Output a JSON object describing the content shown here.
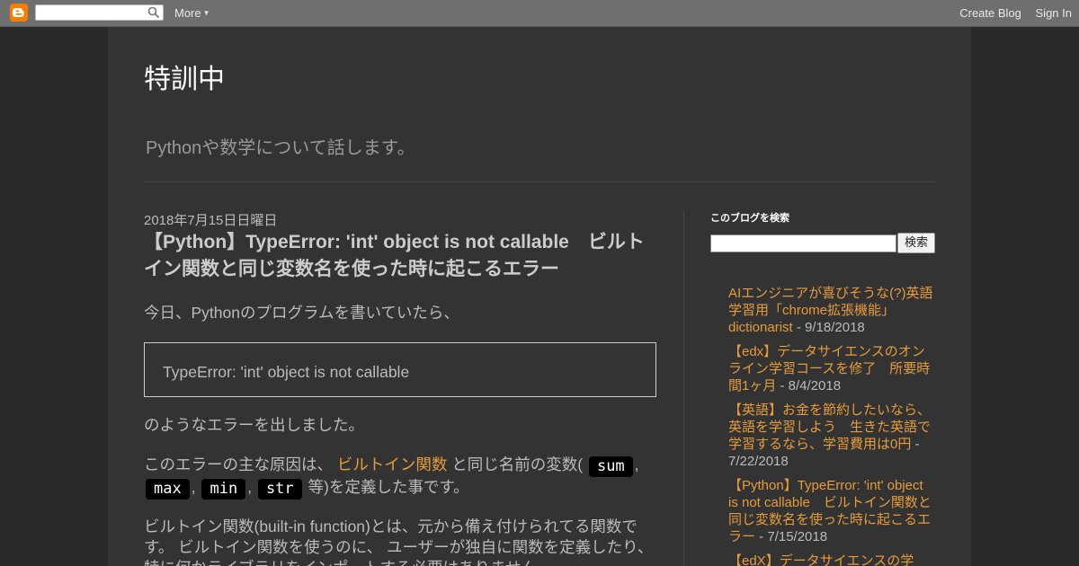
{
  "navbar": {
    "more_label": "More",
    "create_blog": "Create Blog",
    "sign_in": "Sign In"
  },
  "blog": {
    "title": "特訓中",
    "description": "Pythonや数学について話します。"
  },
  "post": {
    "date": "2018年7月15日日曜日",
    "title": "【Python】TypeError: 'int' object is not callable　ビルトイン関数と同じ変数名を使った時に起こるエラー",
    "p1": "今日、Pythonのプログラムを書いていたら、",
    "code_block": "TypeError: 'int' object is not callable",
    "p2": "のようなエラーを出しました。",
    "p3_prefix": "このエラーの主な原因は、",
    "p3_link": "ビルトイン関数",
    "p3_mid": "と同じ名前の変数(",
    "codes": [
      "sum",
      "max",
      "min",
      "str"
    ],
    "sep": ",",
    "p3_suffix": "等)を定義した事です。",
    "p4": "ビルトイン関数(built-in function)とは、元から備え付けられてる関数です。 ビルトイン関数を使うのに、 ユーザーが独自に関数を定義したり、特に何かライブラリをインポートする必要はありません。"
  },
  "sidebar": {
    "search_heading": "このブログを検索",
    "search_button": "検索",
    "posts": [
      {
        "title": "AIエンジニアが喜びそうな(?)英語学習用「chrome拡張機能」dictionarist",
        "date": " - 9/18/2018"
      },
      {
        "title": "【edx】データサイエンスのオンライン学習コースを修了　所要時間1ヶ月",
        "date": " - 8/4/2018"
      },
      {
        "title": "【英語】お金を節約したいなら、英語を学習しよう　生きた英語で学習するなら、学習費用は0円",
        "date": " - 7/22/2018"
      },
      {
        "title": "【Python】TypeError: 'int' object is not callable　ビルトイン関数と同じ変数名を使った時に起こるエラー",
        "date": " - 7/15/2018"
      },
      {
        "title": "【edX】データサイエンスの学",
        "date": ""
      }
    ]
  },
  "colors": {
    "link": "#e69b3c",
    "background": "#292929",
    "content_bg": "#333333"
  }
}
